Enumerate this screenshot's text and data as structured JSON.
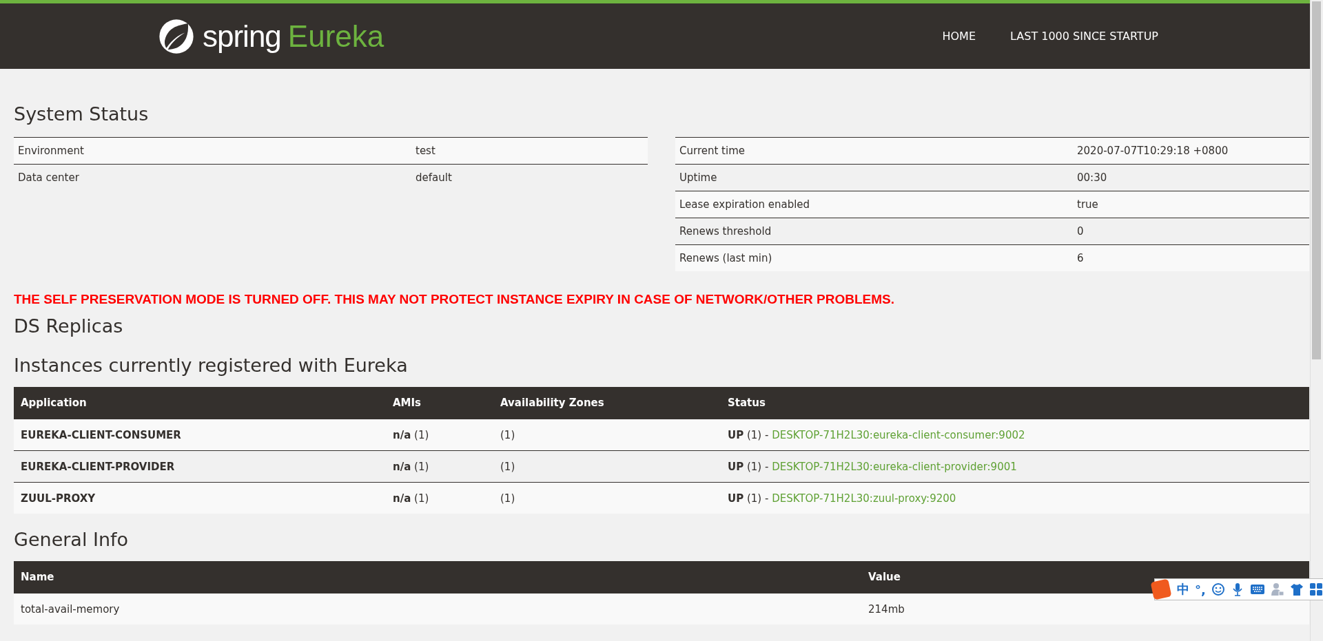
{
  "header": {
    "brand": "spring",
    "product": "Eureka",
    "nav": [
      {
        "label": "HOME"
      },
      {
        "label": "LAST 1000 SINCE STARTUP"
      }
    ]
  },
  "system_status": {
    "title": "System Status",
    "left_rows": [
      {
        "label": "Environment",
        "value": "test"
      },
      {
        "label": "Data center",
        "value": "default"
      }
    ],
    "right_rows": [
      {
        "label": "Current time",
        "value": "2020-07-07T10:29:18 +0800"
      },
      {
        "label": "Uptime",
        "value": "00:30"
      },
      {
        "label": "Lease expiration enabled",
        "value": "true"
      },
      {
        "label": "Renews threshold",
        "value": "0"
      },
      {
        "label": "Renews (last min)",
        "value": "6"
      }
    ]
  },
  "warning": "THE SELF PRESERVATION MODE IS TURNED OFF. THIS MAY NOT PROTECT INSTANCE EXPIRY IN CASE OF NETWORK/OTHER PROBLEMS.",
  "ds_replicas": {
    "title": "DS Replicas"
  },
  "instances": {
    "title": "Instances currently registered with Eureka",
    "columns": [
      "Application",
      "AMIs",
      "Availability Zones",
      "Status"
    ],
    "rows": [
      {
        "application": "EUREKA-CLIENT-CONSUMER",
        "amis": "**n/a** (1)",
        "zones": "(1)",
        "status": "**UP** (1) - ",
        "link": "DESKTOP-71H2L30:eureka-client-consumer:9002"
      },
      {
        "application": "EUREKA-CLIENT-PROVIDER",
        "amis": "**n/a** (1)",
        "zones": "(1)",
        "status": "**UP** (1) - ",
        "link": "DESKTOP-71H2L30:eureka-client-provider:9001"
      },
      {
        "application": "ZUUL-PROXY",
        "amis": "**n/a** (1)",
        "zones": "(1)",
        "status": "**UP** (1) - ",
        "link": "DESKTOP-71H2L30:zuul-proxy:9200"
      }
    ]
  },
  "general_info": {
    "title": "General Info",
    "columns": [
      "Name",
      "Value"
    ],
    "rows": [
      {
        "name": "total-avail-memory",
        "value": "214mb"
      }
    ]
  },
  "ime_toolbar": {
    "mode": "中",
    "punct": "°,"
  }
}
